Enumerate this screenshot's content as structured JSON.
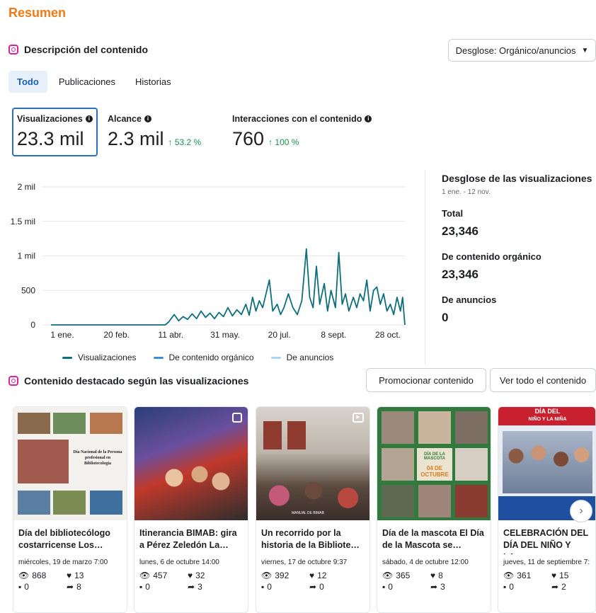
{
  "page": {
    "title": "Resumen"
  },
  "overview": {
    "header": "Descripción del contenido",
    "breakdown_dropdown": "Desglose: Orgánico/anuncios",
    "tabs": [
      {
        "label": "Todo",
        "active": true
      },
      {
        "label": "Publicaciones",
        "active": false
      },
      {
        "label": "Historias",
        "active": false
      }
    ],
    "metrics": [
      {
        "label": "Visualizaciones",
        "value": "23.3 mil",
        "change": ""
      },
      {
        "label": "Alcance",
        "value": "2.3 mil",
        "change": "↑ 53.2 %"
      },
      {
        "label": "Interacciones con el contenido",
        "value": "760",
        "change": "↑ 100 %"
      }
    ]
  },
  "chart_data": {
    "type": "line",
    "title": "",
    "xlabel": "",
    "ylabel": "",
    "ylim": [
      0,
      2000
    ],
    "y_ticks": [
      "2 mil",
      "1.5 mil",
      "1 mil",
      "500",
      "0"
    ],
    "x_ticks": [
      "1 ene.",
      "20 feb.",
      "11 abr.",
      "31 may.",
      "20 jul.",
      "8 sept.",
      "28 oct."
    ],
    "grid": true,
    "legend_position": "bottom",
    "days": 316,
    "series": [
      {
        "name": "Visualizaciones",
        "color": "#0e6f7a",
        "points": [
          [
            0,
            0
          ],
          [
            102,
            0
          ],
          [
            105,
            40
          ],
          [
            110,
            150
          ],
          [
            114,
            60
          ],
          [
            118,
            120
          ],
          [
            122,
            80
          ],
          [
            126,
            160
          ],
          [
            130,
            90
          ],
          [
            134,
            200
          ],
          [
            138,
            110
          ],
          [
            142,
            170
          ],
          [
            146,
            90
          ],
          [
            150,
            180
          ],
          [
            154,
            120
          ],
          [
            158,
            250
          ],
          [
            162,
            130
          ],
          [
            166,
            220
          ],
          [
            170,
            150
          ],
          [
            174,
            300
          ],
          [
            177,
            140
          ],
          [
            180,
            400
          ],
          [
            183,
            200
          ],
          [
            186,
            350
          ],
          [
            189,
            250
          ],
          [
            192,
            450
          ],
          [
            195,
            650
          ],
          [
            198,
            200
          ],
          [
            202,
            300
          ],
          [
            205,
            150
          ],
          [
            208,
            250
          ],
          [
            212,
            450
          ],
          [
            216,
            250
          ],
          [
            220,
            150
          ],
          [
            224,
            350
          ],
          [
            228,
            1100
          ],
          [
            231,
            400
          ],
          [
            234,
            250
          ],
          [
            237,
            850
          ],
          [
            240,
            300
          ],
          [
            244,
            600
          ],
          [
            247,
            200
          ],
          [
            250,
            500
          ],
          [
            254,
            250
          ],
          [
            257,
            1050
          ],
          [
            260,
            300
          ],
          [
            263,
            450
          ],
          [
            266,
            200
          ],
          [
            270,
            400
          ],
          [
            273,
            250
          ],
          [
            276,
            450
          ],
          [
            279,
            350
          ],
          [
            282,
            650
          ],
          [
            285,
            200
          ],
          [
            288,
            500
          ],
          [
            291,
            550
          ],
          [
            294,
            300
          ],
          [
            297,
            450
          ],
          [
            300,
            200
          ],
          [
            303,
            300
          ],
          [
            306,
            150
          ],
          [
            309,
            400
          ],
          [
            312,
            200
          ],
          [
            314,
            400
          ],
          [
            316,
            0
          ]
        ]
      },
      {
        "name": "De contenido orgánico",
        "color": "#3b8fd9"
      },
      {
        "name": "De anuncios",
        "color": "#a9d4f5"
      }
    ]
  },
  "side_panel": {
    "title": "Desglose de las visualizaciones",
    "date_range": "1 ene. - 12 nov.",
    "items": [
      {
        "label": "Total",
        "value": "23,346"
      },
      {
        "label": "De contenido orgánico",
        "value": "23,346"
      },
      {
        "label": "De anuncios",
        "value": "0"
      }
    ]
  },
  "featured": {
    "header": "Contenido destacado según las visualizaciones",
    "promote_button": "Promocionar contenido",
    "view_all_button": "Ver todo el contenido",
    "cards": [
      {
        "title": "Día del bibliotecólogo costarricense Los…",
        "date": "miércoles, 19 de marzo 7:00",
        "views": "868",
        "likes": "13",
        "comments": "0",
        "shares": "8",
        "type": "collage"
      },
      {
        "title": "Itinerancia BIMAB: gira a Pérez Zeledón La…",
        "date": "lunes, 6 de octubre 14:00",
        "views": "457",
        "likes": "32",
        "comments": "0",
        "shares": "3",
        "type": "photo"
      },
      {
        "title": "Un recorrido por la historia de la Bibliote…",
        "date": "viernes, 17 de octubre 9:37",
        "views": "392",
        "likes": "12",
        "comments": "0",
        "shares": "0",
        "type": "photo"
      },
      {
        "title": "Día de la mascota El Día de la Mascota se…",
        "date": "sábado, 4 de octubre 12:00",
        "views": "365",
        "likes": "8",
        "comments": "0",
        "shares": "3",
        "type": "collage"
      },
      {
        "title": "CELEBRACIÓN DEL DÍA DEL NIÑO Y LA…",
        "date": "jueves, 11 de septiembre 7:",
        "views": "361",
        "likes": "15",
        "comments": "0",
        "shares": "2",
        "type": "photo"
      }
    ],
    "thumb_text": {
      "card1": "Día Nacional de la Persona profesional en Bibliotecología",
      "card3_caption": "MANUAL DE BIMAB",
      "card4_top": "DÍA DE LA MASCOTA",
      "card4_bottom": "04 DE OCTUBRE",
      "card5_banner1": "DÍA DEL",
      "card5_banner2": "NIÑO Y LA NIÑA"
    }
  }
}
